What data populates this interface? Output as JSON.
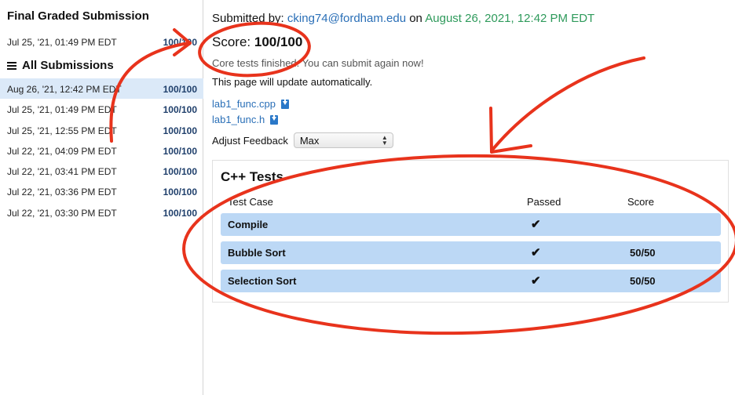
{
  "sidebar": {
    "final_title": "Final Graded Submission",
    "final": {
      "date": "Jul 25, '21, 01:49 PM EDT",
      "score": "100/100"
    },
    "all_title": "All Submissions",
    "submissions": [
      {
        "date": "Aug 26, '21, 12:42 PM EDT",
        "score": "100/100"
      },
      {
        "date": "Jul 25, '21, 01:49 PM EDT",
        "score": "100/100"
      },
      {
        "date": "Jul 25, '21, 12:55 PM EDT",
        "score": "100/100"
      },
      {
        "date": "Jul 22, '21, 04:09 PM EDT",
        "score": "100/100"
      },
      {
        "date": "Jul 22, '21, 03:41 PM EDT",
        "score": "100/100"
      },
      {
        "date": "Jul 22, '21, 03:36 PM EDT",
        "score": "100/100"
      },
      {
        "date": "Jul 22, '21, 03:30 PM EDT",
        "score": "100/100"
      }
    ]
  },
  "main": {
    "submitted_by_label": "Submitted by:",
    "email": "cking74@fordham.edu",
    "on_word": "on",
    "submitted_date": "August 26, 2021, 12:42 PM EDT",
    "score_label": "Score:",
    "score_value": "100/100",
    "status_text": "Core tests finished. You can submit again now!",
    "auto_update_text": "This page will update automatically.",
    "files": [
      {
        "name": "lab1_func.cpp",
        "icon": "download-icon"
      },
      {
        "name": "lab1_func.h",
        "icon": "download-icon"
      }
    ],
    "adjust_label": "Adjust Feedback",
    "adjust_value": "Max"
  },
  "tests": {
    "title": "C++ Tests",
    "headers": {
      "case": "Test Case",
      "passed": "Passed",
      "score": "Score"
    },
    "rows": [
      {
        "name": "Compile",
        "passed": "✔",
        "score": ""
      },
      {
        "name": "Bubble Sort",
        "passed": "✔",
        "score": "50/50"
      },
      {
        "name": "Selection Sort",
        "passed": "✔",
        "score": "50/50"
      }
    ]
  },
  "colors": {
    "link": "#2a6fb7",
    "date_green": "#2e9a5b",
    "row_active": "#dbe9f8",
    "test_row": "#bcd8f5",
    "annotation": "#e8331c"
  }
}
